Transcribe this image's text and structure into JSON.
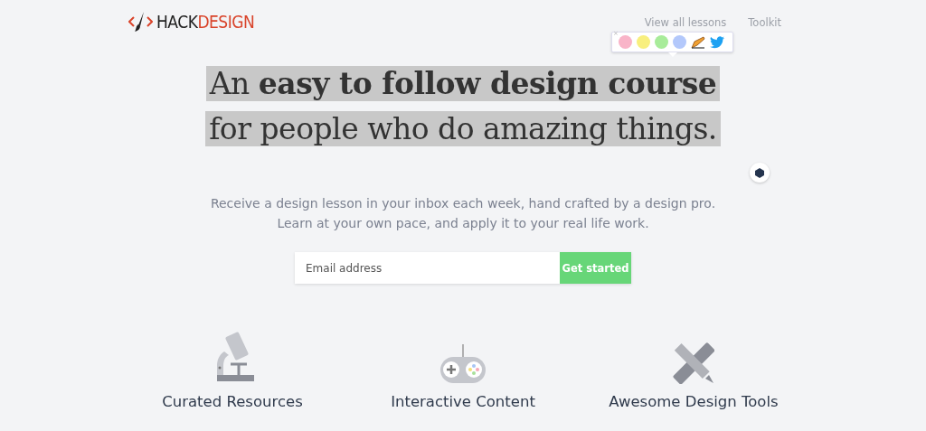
{
  "logo": {
    "word_1": "HACK",
    "word_2": "DESIGN"
  },
  "nav": [
    {
      "label": "View all lessons"
    },
    {
      "label": "Toolkit"
    }
  ],
  "highlight_popup": {
    "close": "×",
    "swatches": [
      {
        "color": "#f9b4c8"
      },
      {
        "color": "#f8ef7e"
      },
      {
        "color": "#a8ec9a"
      },
      {
        "color": "#b3c8fb"
      }
    ]
  },
  "headline": {
    "lines": [
      "An **easy to follow design course**",
      "for people who do amazing things."
    ],
    "highlighted": true
  },
  "subtitle": [
    "Receive a design lesson in your inbox each week, hand crafted by a design pro.",
    "Learn at your own pace, and apply it to your real life work."
  ],
  "signup": {
    "placeholder": "Email address",
    "button": "Get started"
  },
  "features": [
    {
      "kind": "microscope",
      "title": "Curated Resources"
    },
    {
      "kind": "gamepad",
      "title": "Interactive Content"
    },
    {
      "kind": "tools",
      "title": "Awesome Design Tools"
    }
  ]
}
